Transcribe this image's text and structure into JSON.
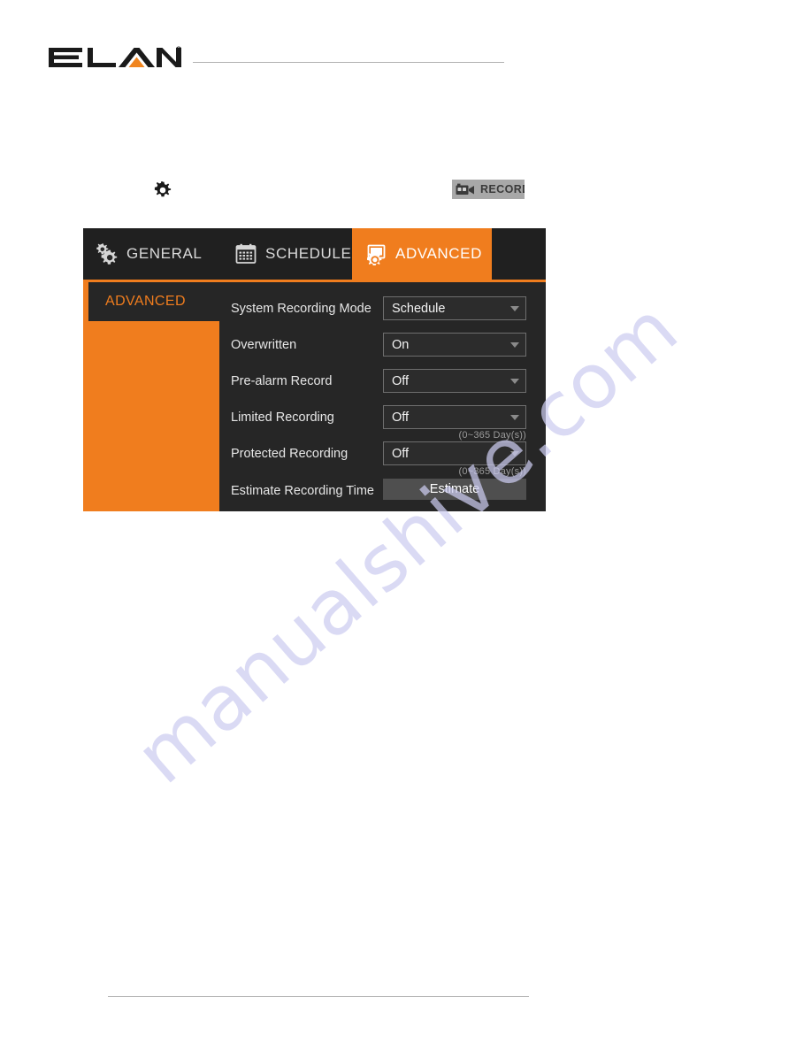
{
  "document": {
    "brand": "ELAN",
    "brand_trademark": "®",
    "watermark": "manualshive.com"
  },
  "toolbar": {
    "gear_icon": "gear-icon",
    "record": {
      "icon": "camcorder-icon",
      "label": "RECORD"
    }
  },
  "tabs": [
    {
      "id": "general",
      "label": "GENERAL",
      "icon": "gears-icon",
      "active": false
    },
    {
      "id": "schedule",
      "label": "SCHEDULE",
      "icon": "calendar-icon",
      "active": false
    },
    {
      "id": "advanced",
      "label": "ADVANCED",
      "icon": "settings-frame-icon",
      "active": true
    }
  ],
  "sidebar": {
    "items": [
      {
        "label": "ADVANCED",
        "selected": true
      }
    ]
  },
  "form": {
    "rows": [
      {
        "label": "System Recording Mode",
        "control": "select",
        "value": "Schedule",
        "hint": ""
      },
      {
        "label": "Overwritten",
        "control": "select",
        "value": "On",
        "hint": ""
      },
      {
        "label": "Pre-alarm Record",
        "control": "select",
        "value": "Off",
        "hint": ""
      },
      {
        "label": "Limited Recording",
        "control": "select",
        "value": "Off",
        "hint": "(0~365 Day(s))"
      },
      {
        "label": "Protected Recording",
        "control": "select",
        "value": "Off",
        "hint": "(0~365 Day(s))"
      },
      {
        "label": "Estimate Recording Time",
        "control": "button",
        "value": "Estimate",
        "hint": ""
      }
    ]
  },
  "colors": {
    "accent_orange": "#f07d1e",
    "panel_dark": "#262626",
    "tabbar_dark": "#202020",
    "record_grey": "#a8a8a8",
    "button_grey": "#4f4f4f",
    "watermark_blue": "#ccccf0"
  }
}
